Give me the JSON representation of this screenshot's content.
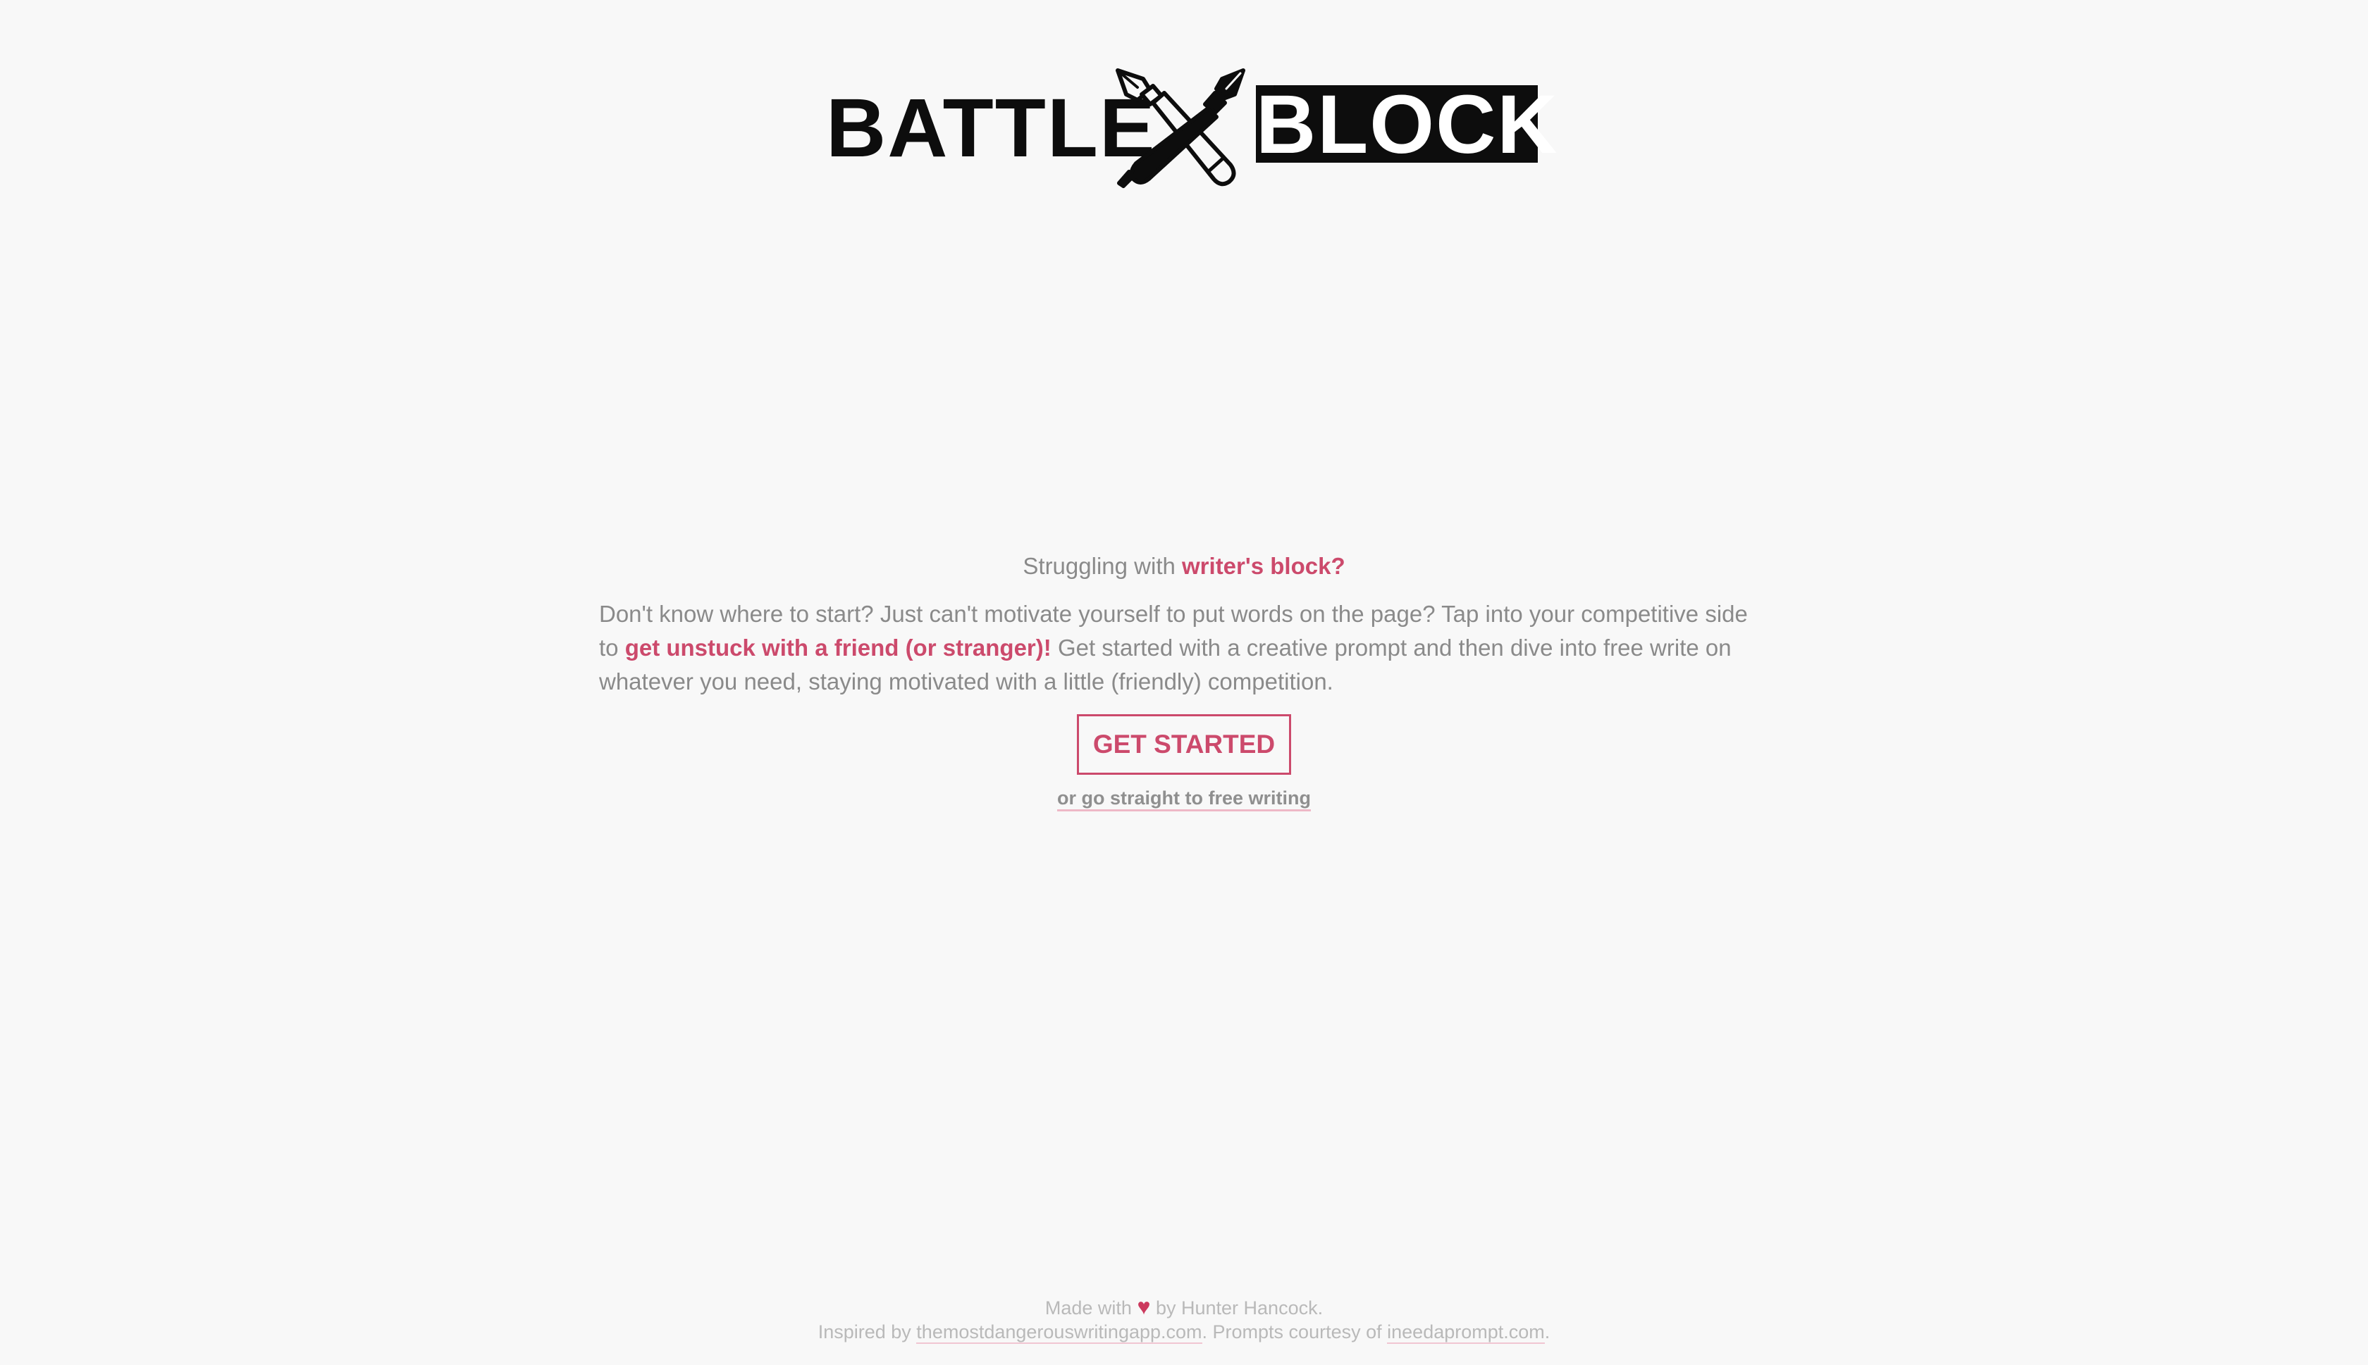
{
  "logo": {
    "left_word": "BATTLE",
    "right_word": "BLOCK",
    "icon": "crossed-pens-icon"
  },
  "intro": {
    "headline_prefix": "Struggling with",
    "headline_accent": "writer's block?",
    "desc_part1": "Don't know where to start? Just can't motivate yourself to put words on the page? Tap into your competitive side to",
    "desc_accent": "get unstuck with a friend (or stranger)!",
    "desc_part2": "Get started with a creative prompt and then dive into free write on whatever you need, staying motivated with a little (friendly) competition."
  },
  "cta": {
    "label": "GET STARTED"
  },
  "free_link": {
    "label": "or go straight to free writing"
  },
  "footer": {
    "made_prefix": "Made with",
    "heart": "♥",
    "made_suffix": "by Hunter Hancock.",
    "inspired_prefix": "Inspired by",
    "inspired_link": "themostdangerouswritingapp.com",
    "prompts_text": ". Prompts courtesy of",
    "prompts_link": "ineedaprompt.com",
    "end_period": "."
  },
  "colors": {
    "background": "#f8f8f8",
    "accent": "#cc4a6c",
    "text": "#8a8a8a",
    "logo": "#0d0d0d"
  }
}
